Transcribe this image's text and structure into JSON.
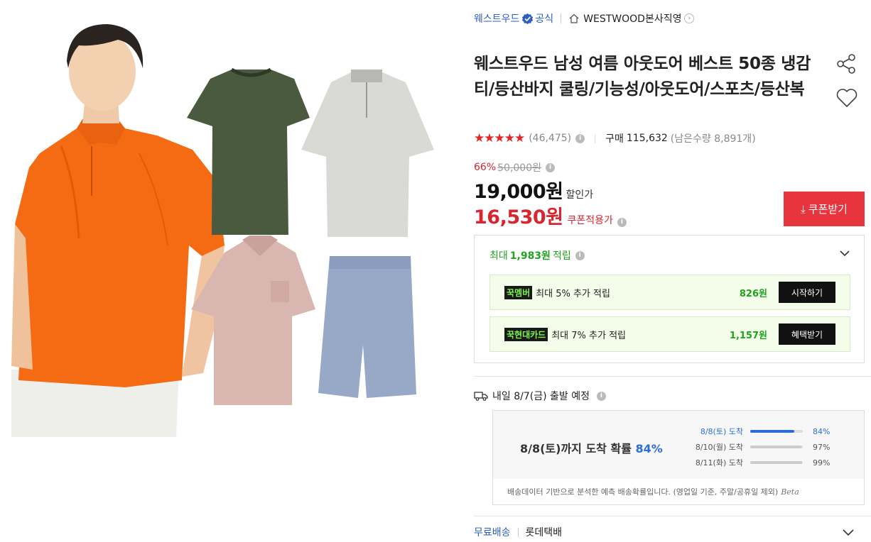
{
  "seller": {
    "brand": "웨스트우드",
    "official": "공식",
    "store": "WESTWOOD본사직영"
  },
  "product": {
    "title": "웨스트우드 남성 여름 아웃도어 베스트 50종 냉감티/등산바지 쿨링/기능성/아웃도어/스포츠/등산복"
  },
  "rating": {
    "stars_value": 4.5,
    "stars": "★★★★★",
    "review_count": "(46,475)",
    "purchase_label": "구매",
    "purchase_count": "115,632",
    "remaining": "(남은수량 8,891개)"
  },
  "price": {
    "discount_rate": "66%",
    "original": "50,000원",
    "sale": "19,000원",
    "sale_label": "할인가",
    "coupon_price": "16,530원",
    "coupon_label": "쿠폰적용가",
    "coupon_button": "쿠폰받기"
  },
  "points": {
    "prefix": "최대",
    "amount": "1,983원",
    "suffix": "적립",
    "cards": [
      {
        "tag_mark": "꾹",
        "tag": "멤버",
        "text": "최대 5% 추가 적립",
        "amount": "826원",
        "button": "시작하기"
      },
      {
        "tag_mark": "꾹",
        "tag": "현대카드",
        "text": "최대 7% 추가 적립",
        "amount": "1,157원",
        "button": "혜택받기"
      }
    ]
  },
  "shipping": {
    "departure": "내일 8/7(금) 출발 예정",
    "prob_prefix": "8/8(토)까지 도착 확률",
    "prob_value": "84%",
    "prob_list": [
      {
        "date": "8/8(토) 도착",
        "pct": "84%",
        "value": 0.84
      },
      {
        "date": "8/10(월) 도착",
        "pct": "97%",
        "value": 0.97
      },
      {
        "date": "8/11(화) 도착",
        "pct": "99%",
        "value": 0.99
      }
    ],
    "note": "배송데이터 기반으로 분석한 예측 배송확률입니다. (영업일 기준, 주말/공휴일 제외)",
    "beta": "Beta",
    "free_label": "무료배송",
    "carrier": "롯데택배"
  },
  "colors": {
    "accent_red": "#E8343C",
    "link_blue": "#2B5EC4",
    "green": "#1FA31F",
    "prob_blue": "#2B6FD6"
  }
}
